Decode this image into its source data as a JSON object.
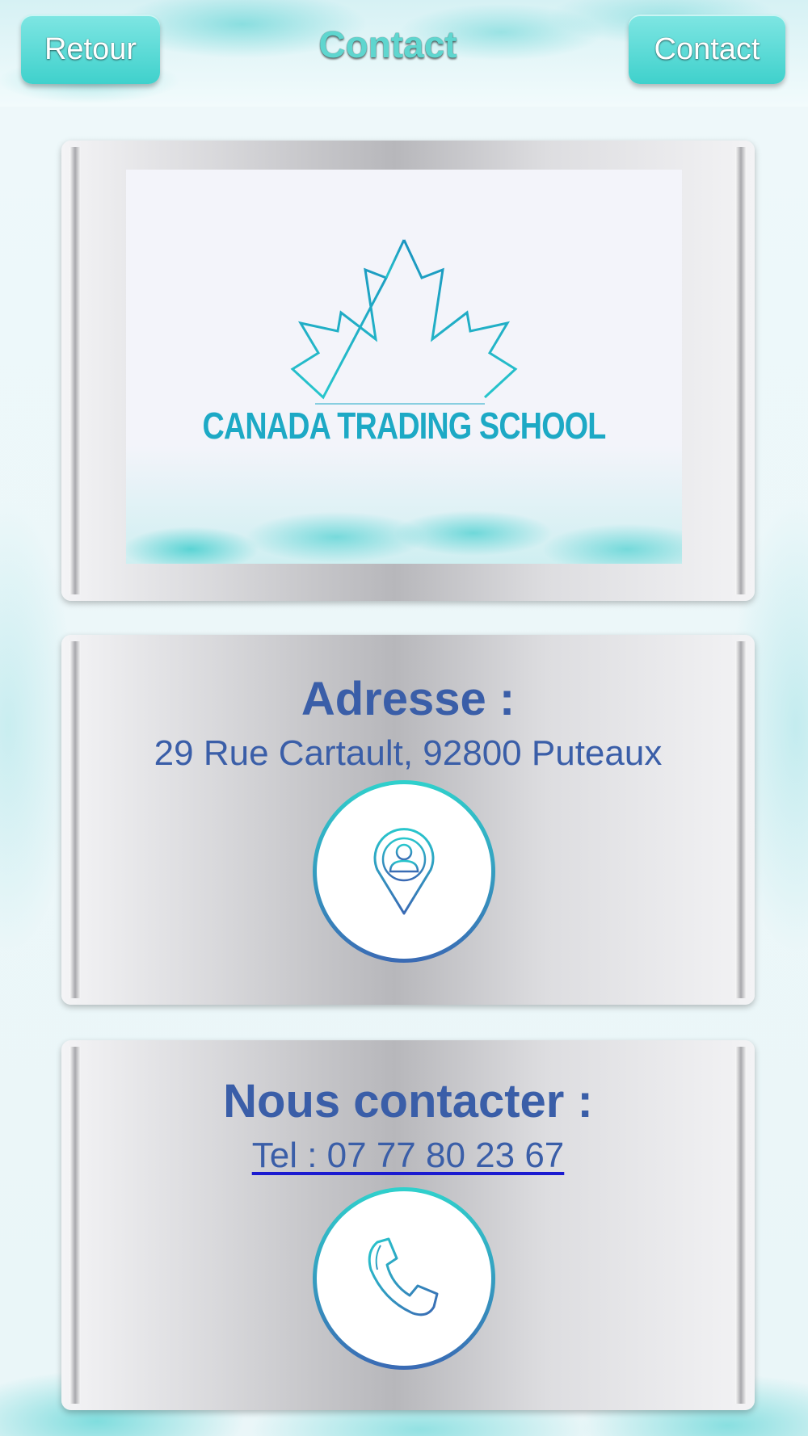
{
  "header": {
    "back_label": "Retour",
    "title": "Contact",
    "contact_label": "Contact"
  },
  "logo": {
    "brand_text": "CANADA TRADING SCHOOL",
    "icon": "maple-leaf-icon"
  },
  "address_section": {
    "title": "Adresse :",
    "address": "29 Rue Cartault, 92800 Puteaux",
    "icon": "map-pin-person-icon"
  },
  "contact_section": {
    "title": "Nous contacter :",
    "phone": "Tel : 07 77 80 23 67",
    "icon": "phone-icon"
  },
  "colors": {
    "accent": "#3fd1cc",
    "text_blue": "#3a5ea8",
    "logo_blue": "#1da9c5",
    "link_underline": "#1a1ad0"
  }
}
